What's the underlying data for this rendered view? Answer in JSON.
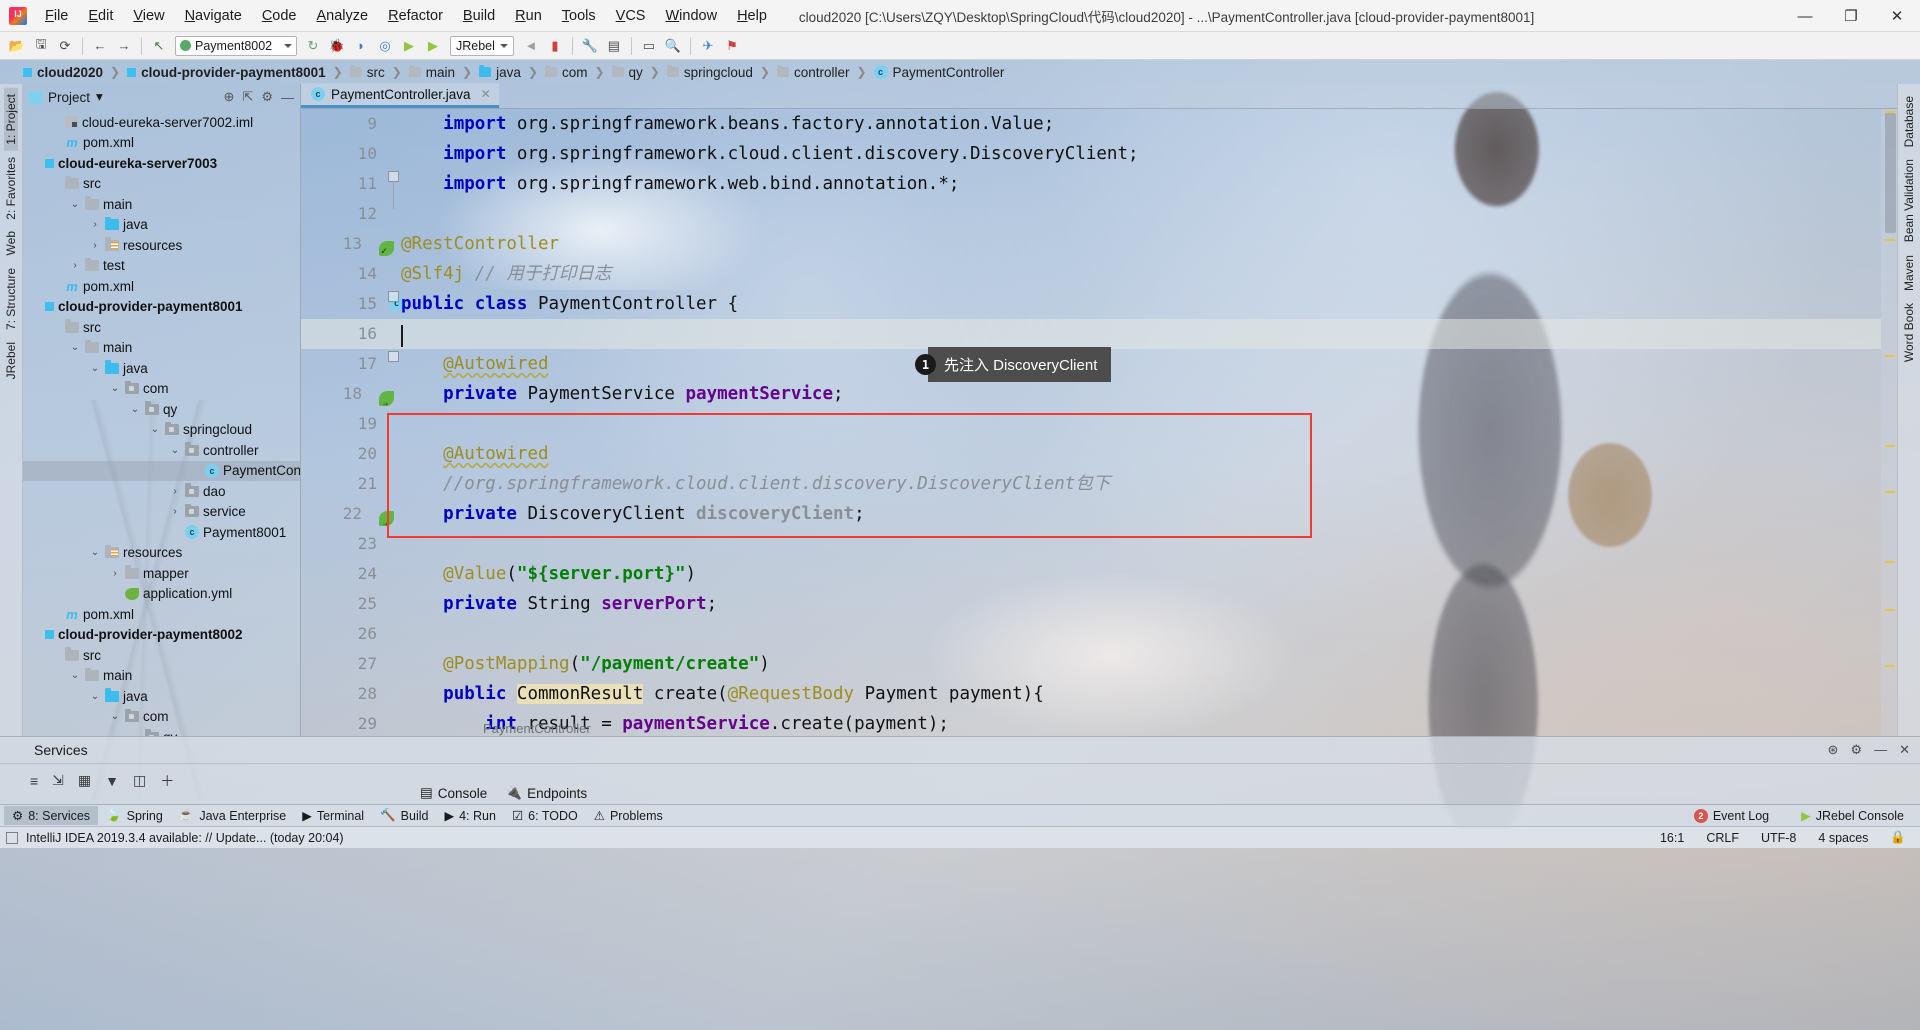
{
  "window": {
    "title": "cloud2020 [C:\\Users\\ZQY\\Desktop\\SpringCloud\\代码\\cloud2020] - ...\\PaymentController.java [cloud-provider-payment8001]",
    "minimize": "—",
    "maximize": "❐",
    "close": "✕"
  },
  "menu": [
    "File",
    "Edit",
    "View",
    "Navigate",
    "Code",
    "Analyze",
    "Refactor",
    "Build",
    "Run",
    "Tools",
    "VCS",
    "Window",
    "Help"
  ],
  "toolbar": {
    "run_config": "Payment8002",
    "jrebel": "JRebel",
    "icons": [
      "open-icon",
      "save-icon",
      "sync-icon",
      "back-icon",
      "forward-icon",
      "undo-icon",
      "rerun-icon",
      "debug-icon",
      "run-with-coverage-icon",
      "profile-icon",
      "jrebel-run-icon",
      "jrebel-debug-icon",
      "jrebel-extra-icon",
      "jrebel-stop-icon",
      "settings-icon",
      "project-structure-icon",
      "sdk-icon",
      "search-icon",
      "bug-tracker-icon",
      "notification-icon"
    ]
  },
  "breadcrumb": [
    {
      "label": "cloud2020",
      "icon": "module-icon",
      "bold": true
    },
    {
      "label": "cloud-provider-payment8001",
      "icon": "module-icon",
      "bold": true
    },
    {
      "label": "src",
      "icon": "folder-icon",
      "bold": false
    },
    {
      "label": "main",
      "icon": "folder-icon",
      "bold": false
    },
    {
      "label": "java",
      "icon": "source-folder-icon",
      "bold": false
    },
    {
      "label": "com",
      "icon": "package-icon",
      "bold": false
    },
    {
      "label": "qy",
      "icon": "package-icon",
      "bold": false
    },
    {
      "label": "springcloud",
      "icon": "package-icon",
      "bold": false
    },
    {
      "label": "controller",
      "icon": "package-icon",
      "bold": false
    },
    {
      "label": "PaymentController",
      "icon": "class-icon",
      "bold": false
    }
  ],
  "left_strip": [
    {
      "label": "1: Project",
      "selected": true
    },
    {
      "label": "2: Favorites",
      "selected": false
    },
    {
      "label": "Web",
      "selected": false
    },
    {
      "label": "7: Structure",
      "selected": false
    },
    {
      "label": "JRebel",
      "selected": false
    }
  ],
  "right_strip": [
    {
      "label": "Database"
    },
    {
      "label": "Bean Validation"
    },
    {
      "label": "Maven"
    },
    {
      "label": "Word Book"
    }
  ],
  "project_panel": {
    "title": "Project",
    "dropdown_caret": "▾",
    "tools": [
      "locate-icon",
      "collapse-all-icon",
      "settings-icon",
      "hide-icon"
    ],
    "tree": [
      {
        "label": "cloud-eureka-server7002.iml",
        "indent": 1,
        "icon": "iml-icon",
        "arrow": "",
        "bold": false,
        "selected": false
      },
      {
        "label": "pom.xml",
        "indent": 1,
        "icon": "maven-icon",
        "arrow": "",
        "bold": false,
        "selected": false
      },
      {
        "label": "cloud-eureka-server7003",
        "indent": 0,
        "icon": "module-icon",
        "arrow": "",
        "bold": true,
        "selected": false
      },
      {
        "label": "src",
        "indent": 1,
        "icon": "folder-icon",
        "arrow": "",
        "bold": false,
        "selected": false
      },
      {
        "label": "main",
        "indent": 2,
        "icon": "folder-icon",
        "arrow": "v",
        "bold": false,
        "selected": false
      },
      {
        "label": "java",
        "indent": 3,
        "icon": "source-folder-icon",
        "arrow": ">",
        "bold": false,
        "selected": false
      },
      {
        "label": "resources",
        "indent": 3,
        "icon": "resources-folder-icon",
        "arrow": ">",
        "bold": false,
        "selected": false
      },
      {
        "label": "test",
        "indent": 2,
        "icon": "folder-icon",
        "arrow": ">",
        "bold": false,
        "selected": false
      },
      {
        "label": "pom.xml",
        "indent": 1,
        "icon": "maven-icon",
        "arrow": "",
        "bold": false,
        "selected": false
      },
      {
        "label": "cloud-provider-payment8001",
        "indent": 0,
        "icon": "module-icon",
        "arrow": "",
        "bold": true,
        "selected": false
      },
      {
        "label": "src",
        "indent": 1,
        "icon": "folder-icon",
        "arrow": "",
        "bold": false,
        "selected": false
      },
      {
        "label": "main",
        "indent": 2,
        "icon": "folder-icon",
        "arrow": "v",
        "bold": false,
        "selected": false
      },
      {
        "label": "java",
        "indent": 3,
        "icon": "source-folder-icon",
        "arrow": "v",
        "bold": false,
        "selected": false
      },
      {
        "label": "com",
        "indent": 4,
        "icon": "package-icon",
        "arrow": "v",
        "bold": false,
        "selected": false
      },
      {
        "label": "qy",
        "indent": 5,
        "icon": "package-icon",
        "arrow": "v",
        "bold": false,
        "selected": false
      },
      {
        "label": "springcloud",
        "indent": 6,
        "icon": "package-icon",
        "arrow": "v",
        "bold": false,
        "selected": false
      },
      {
        "label": "controller",
        "indent": 7,
        "icon": "package-icon",
        "arrow": "v",
        "bold": false,
        "selected": false
      },
      {
        "label": "PaymentController",
        "indent": 8,
        "icon": "class-icon",
        "arrow": "",
        "bold": false,
        "selected": true
      },
      {
        "label": "dao",
        "indent": 7,
        "icon": "package-icon",
        "arrow": ">",
        "bold": false,
        "selected": false
      },
      {
        "label": "service",
        "indent": 7,
        "icon": "package-icon",
        "arrow": ">",
        "bold": false,
        "selected": false
      },
      {
        "label": "Payment8001",
        "indent": 7,
        "icon": "spring-class-icon",
        "arrow": "",
        "bold": false,
        "selected": false
      },
      {
        "label": "resources",
        "indent": 3,
        "icon": "resources-folder-icon",
        "arrow": "v",
        "bold": false,
        "selected": false
      },
      {
        "label": "mapper",
        "indent": 4,
        "icon": "folder-icon",
        "arrow": ">",
        "bold": false,
        "selected": false
      },
      {
        "label": "application.yml",
        "indent": 4,
        "icon": "spring-yaml-icon",
        "arrow": "",
        "bold": false,
        "selected": false
      },
      {
        "label": "pom.xml",
        "indent": 1,
        "icon": "maven-icon",
        "arrow": "",
        "bold": false,
        "selected": false
      },
      {
        "label": "cloud-provider-payment8002",
        "indent": 0,
        "icon": "module-icon",
        "arrow": "",
        "bold": true,
        "selected": false
      },
      {
        "label": "src",
        "indent": 1,
        "icon": "folder-icon",
        "arrow": "",
        "bold": false,
        "selected": false
      },
      {
        "label": "main",
        "indent": 2,
        "icon": "folder-icon",
        "arrow": "v",
        "bold": false,
        "selected": false
      },
      {
        "label": "java",
        "indent": 3,
        "icon": "source-folder-icon",
        "arrow": "v",
        "bold": false,
        "selected": false
      },
      {
        "label": "com",
        "indent": 4,
        "icon": "package-icon",
        "arrow": "v",
        "bold": false,
        "selected": false
      },
      {
        "label": "qy",
        "indent": 5,
        "icon": "package-icon",
        "arrow": "v",
        "bold": false,
        "selected": false
      }
    ]
  },
  "editor": {
    "tab": {
      "label": "PaymentController.java",
      "icon": "class-icon",
      "close": "✕"
    },
    "breadcrumb_bottom": "PaymentController",
    "caret_position": "16:1",
    "lines": [
      {
        "num": "9",
        "marker": "",
        "cur": false,
        "tokens": [
          {
            "t": "    ",
            "c": "plain"
          },
          {
            "t": "import",
            "c": "kw"
          },
          {
            "t": " org.springframework.beans.factory.annotation.",
            "c": "type"
          },
          {
            "t": "Value",
            "c": "type-accent"
          },
          {
            "t": ";",
            "c": "type"
          }
        ]
      },
      {
        "num": "10",
        "marker": "",
        "cur": false,
        "tokens": [
          {
            "t": "    ",
            "c": "plain"
          },
          {
            "t": "import",
            "c": "kw"
          },
          {
            "t": " org.springframework.cloud.client.discovery.DiscoveryClient;",
            "c": "type"
          }
        ]
      },
      {
        "num": "11",
        "marker": "",
        "cur": false,
        "tokens": [
          {
            "t": "    ",
            "c": "plain"
          },
          {
            "t": "import",
            "c": "kw"
          },
          {
            "t": " org.springframework.web.bind.annotation.*;",
            "c": "type"
          }
        ]
      },
      {
        "num": "12",
        "marker": "",
        "cur": false,
        "tokens": []
      },
      {
        "num": "13",
        "marker": "leaf",
        "cur": false,
        "tokens": [
          {
            "t": "@RestController",
            "c": "ann"
          }
        ]
      },
      {
        "num": "14",
        "marker": "",
        "cur": false,
        "tokens": [
          {
            "t": "@Slf4j ",
            "c": "ann"
          },
          {
            "t": "// 用于打印日志",
            "c": "cmt"
          }
        ]
      },
      {
        "num": "15",
        "marker": "class",
        "cur": false,
        "tokens": [
          {
            "t": "public class",
            "c": "kw"
          },
          {
            "t": " PaymentController {",
            "c": "type"
          }
        ]
      },
      {
        "num": "16",
        "marker": "",
        "cur": true,
        "tokens": []
      },
      {
        "num": "17",
        "marker": "",
        "cur": false,
        "tokens": [
          {
            "t": "    ",
            "c": "plain"
          },
          {
            "t": "@Autowired",
            "c": "ann-wave"
          }
        ]
      },
      {
        "num": "18",
        "marker": "bean",
        "cur": false,
        "tokens": [
          {
            "t": "    ",
            "c": "plain"
          },
          {
            "t": "private",
            "c": "kw"
          },
          {
            "t": " PaymentService ",
            "c": "type"
          },
          {
            "t": "paymentService",
            "c": "fld-name"
          },
          {
            "t": ";",
            "c": "type"
          }
        ]
      },
      {
        "num": "19",
        "marker": "",
        "cur": false,
        "tokens": []
      },
      {
        "num": "20",
        "marker": "",
        "cur": false,
        "tokens": [
          {
            "t": "    ",
            "c": "plain"
          },
          {
            "t": "@Autowired",
            "c": "ann-wave"
          }
        ]
      },
      {
        "num": "21",
        "marker": "",
        "cur": false,
        "tokens": [
          {
            "t": "    ",
            "c": "plain"
          },
          {
            "t": "//org.springframework.cloud.client.discovery.DiscoveryClient包下",
            "c": "cmt"
          }
        ]
      },
      {
        "num": "22",
        "marker": "bean",
        "cur": false,
        "tokens": [
          {
            "t": "    ",
            "c": "plain"
          },
          {
            "t": "private",
            "c": "kw"
          },
          {
            "t": " DiscoveryClient ",
            "c": "type"
          },
          {
            "t": "discoveryClient",
            "c": "fld-gray"
          },
          {
            "t": ";",
            "c": "type"
          }
        ]
      },
      {
        "num": "23",
        "marker": "",
        "cur": false,
        "tokens": []
      },
      {
        "num": "24",
        "marker": "",
        "cur": false,
        "tokens": [
          {
            "t": "    ",
            "c": "plain"
          },
          {
            "t": "@Value",
            "c": "ann"
          },
          {
            "t": "(",
            "c": "type"
          },
          {
            "t": "\"${server.port}\"",
            "c": "str"
          },
          {
            "t": ")",
            "c": "type"
          }
        ]
      },
      {
        "num": "25",
        "marker": "",
        "cur": false,
        "tokens": [
          {
            "t": "    ",
            "c": "plain"
          },
          {
            "t": "private",
            "c": "kw"
          },
          {
            "t": " String ",
            "c": "type"
          },
          {
            "t": "serverPort",
            "c": "fld-name"
          },
          {
            "t": ";",
            "c": "type"
          }
        ]
      },
      {
        "num": "26",
        "marker": "",
        "cur": false,
        "tokens": []
      },
      {
        "num": "27",
        "marker": "",
        "cur": false,
        "tokens": [
          {
            "t": "    ",
            "c": "plain"
          },
          {
            "t": "@PostMapping",
            "c": "ann"
          },
          {
            "t": "(",
            "c": "type"
          },
          {
            "t": "\"/payment/create\"",
            "c": "str"
          },
          {
            "t": ")",
            "c": "type"
          }
        ]
      },
      {
        "num": "28",
        "marker": "",
        "cur": false,
        "tokens": [
          {
            "t": "    ",
            "c": "plain"
          },
          {
            "t": "public",
            "c": "kw"
          },
          {
            "t": " ",
            "c": "type"
          },
          {
            "t": "CommonResult",
            "c": "hl"
          },
          {
            "t": " create(",
            "c": "type"
          },
          {
            "t": "@RequestBody",
            "c": "ann"
          },
          {
            "t": " Payment payment){",
            "c": "type"
          }
        ]
      },
      {
        "num": "29",
        "marker": "",
        "cur": false,
        "tokens": [
          {
            "t": "        ",
            "c": "plain"
          },
          {
            "t": "int",
            "c": "kw"
          },
          {
            "t": " result = ",
            "c": "type"
          },
          {
            "t": "paymentService",
            "c": "fld-name"
          },
          {
            "t": ".create(payment);",
            "c": "type"
          }
        ]
      }
    ],
    "callout": {
      "number": "1",
      "text": "先注入 DiscoveryClient"
    },
    "highlight_box_color": "#f23b2f"
  },
  "services": {
    "title": "Services",
    "toolbar_icons": [
      "expand-icon",
      "collapse-icon",
      "group-icon",
      "filter-icon",
      "layout-icon",
      "add-icon"
    ],
    "header_icons": [
      "help-icon",
      "settings-icon",
      "minimize-icon",
      "close-icon"
    ],
    "tabs": [
      {
        "label": "Console",
        "icon": "console-icon"
      },
      {
        "label": "Endpoints",
        "icon": "endpoints-icon"
      }
    ]
  },
  "bottom_strip": {
    "left_items": [
      {
        "label": "8: Services",
        "icon": "services-icon",
        "selected": true
      },
      {
        "label": "Spring",
        "icon": "spring-icon",
        "selected": false
      },
      {
        "label": "Java Enterprise",
        "icon": "java-icon",
        "selected": false
      },
      {
        "label": "Terminal",
        "icon": "terminal-icon",
        "selected": false
      },
      {
        "label": "Build",
        "icon": "build-icon",
        "selected": false
      },
      {
        "label": "4: Run",
        "icon": "run-icon",
        "selected": false
      },
      {
        "label": "6: TODO",
        "icon": "todo-icon",
        "selected": false
      },
      {
        "label": "Problems",
        "icon": "problems-icon",
        "selected": false
      }
    ],
    "right_items": [
      {
        "label": "Event Log",
        "icon": "event-log-icon",
        "badge": "2"
      },
      {
        "label": "JRebel Console",
        "icon": "jrebel-icon",
        "badge": ""
      }
    ]
  },
  "statusbar": {
    "message": "IntelliJ IDEA 2019.3.4 available: // Update... (today 20:04)",
    "right": [
      "16:1",
      "CRLF",
      "UTF-8",
      "4 spaces"
    ],
    "lock_icon": "lock-icon"
  },
  "colors": {
    "accent_blue": "#3dbbec",
    "keyword": "#0000c0",
    "annotation": "#9e8d1f",
    "string": "#008000",
    "comment": "#8a8f96",
    "field": "#66008c",
    "red_box": "#f23b2f",
    "green_leaf": "#62b543"
  }
}
